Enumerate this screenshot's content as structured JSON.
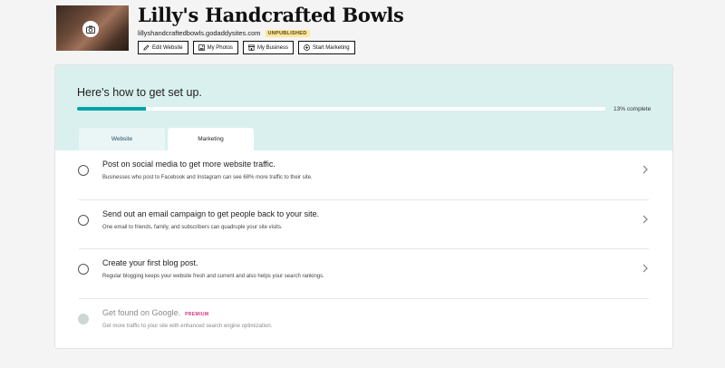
{
  "header": {
    "site_title": "Lilly's Handcrafted Bowls",
    "domain": "lillyshandcraftedbowls.godaddysites.com",
    "status_badge": "UNPUBLISHED",
    "buttons": [
      {
        "label": "Edit Website",
        "icon": "pencil-icon"
      },
      {
        "label": "My Photos",
        "icon": "image-icon"
      },
      {
        "label": "My Business",
        "icon": "store-icon"
      },
      {
        "label": "Start Marketing",
        "icon": "plus-circle-icon"
      }
    ]
  },
  "setup": {
    "title": "Here's how to get set up.",
    "progress_percent": 13,
    "progress_label": "13% complete",
    "tabs": [
      {
        "label": "Website",
        "active": false
      },
      {
        "label": "Marketing",
        "active": true
      }
    ],
    "tasks": [
      {
        "title": "Post on social media to get more website traffic.",
        "description": "Businesses who post to Facebook and Instagram can see 68% more traffic to their site.",
        "locked": false
      },
      {
        "title": "Send out an email campaign to get people back to your site.",
        "description": "One email to friends, family, and subscribers can quadruple your site visits.",
        "locked": false
      },
      {
        "title": "Create your first blog post.",
        "description": "Regular blogging keeps your website fresh and current and also helps your search rankings.",
        "locked": false
      },
      {
        "title": "Get found on Google.",
        "badge": "PREMIUM",
        "description": "Get more traffic to your site with enhanced search engine optimization.",
        "locked": true
      }
    ]
  },
  "colors": {
    "accent": "#00a4a6",
    "setup_bg": "#d9f0ef",
    "badge_bg": "#fde7a4",
    "premium": "#d6317e"
  }
}
